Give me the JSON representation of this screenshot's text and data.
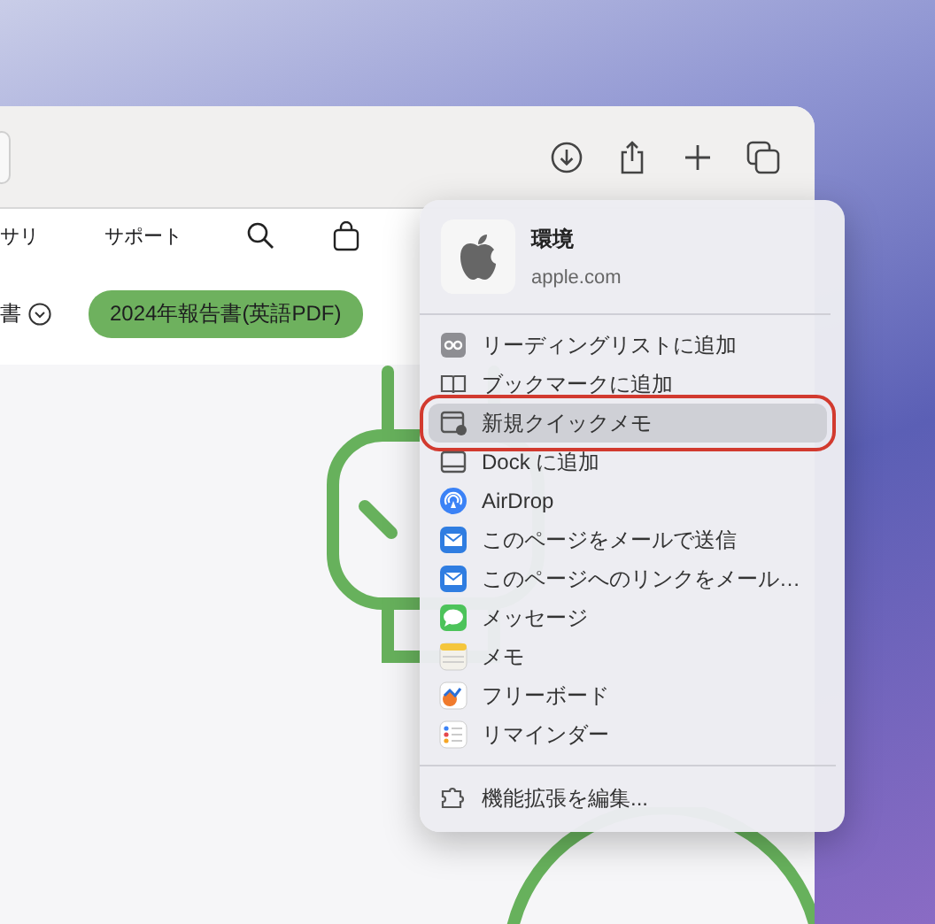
{
  "nav": {
    "items": [
      "サリ",
      "サポート"
    ]
  },
  "subnav": {
    "link": "書",
    "pill": "2024年報告書(英語PDF)"
  },
  "share_menu": {
    "title": "環境",
    "subtitle": "apple.com",
    "items": [
      {
        "kind": "reading-list",
        "label": "リーディングリストに追加",
        "selected": false
      },
      {
        "kind": "bookmark",
        "label": "ブックマークに追加",
        "selected": false
      },
      {
        "kind": "quick-note",
        "label": "新規クイックメモ",
        "selected": true
      },
      {
        "kind": "dock",
        "label": "Dock に追加",
        "selected": false
      },
      {
        "kind": "airdrop",
        "label": "AirDrop",
        "selected": false
      },
      {
        "kind": "mail",
        "label": "このページをメールで送信",
        "selected": false
      },
      {
        "kind": "mail",
        "label": "このページへのリンクをメール…",
        "selected": false
      },
      {
        "kind": "messages",
        "label": "メッセージ",
        "selected": false
      },
      {
        "kind": "notes",
        "label": "メモ",
        "selected": false
      },
      {
        "kind": "freeform",
        "label": "フリーボード",
        "selected": false
      },
      {
        "kind": "reminders",
        "label": "リマインダー",
        "selected": false
      }
    ],
    "footer": {
      "kind": "extensions",
      "label": "機能拡張を編集..."
    }
  }
}
